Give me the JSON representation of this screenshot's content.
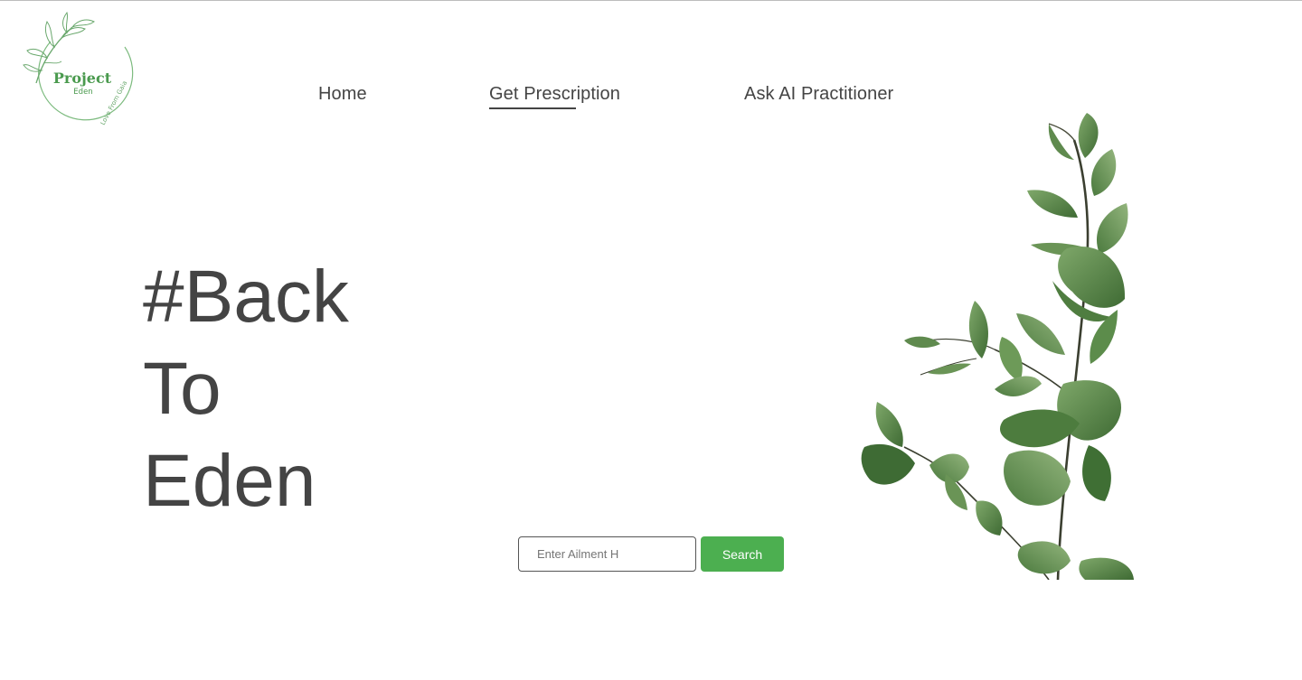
{
  "logo": {
    "title": "Project",
    "subtitle": "Eden",
    "tagline": "Love From Gaia",
    "accent": "#4a9a4e"
  },
  "nav": {
    "items": [
      {
        "label": "Home"
      },
      {
        "label": "Get Prescription",
        "active": true
      },
      {
        "label": "Ask AI Practitioner"
      }
    ]
  },
  "hero": {
    "lines": [
      "#Back",
      "To",
      "Eden"
    ]
  },
  "search": {
    "placeholder": "Enter Ailment H",
    "button_label": "Search",
    "button_color": "#4caf50"
  },
  "decoration": {
    "image": "eucalyptus-branch"
  }
}
